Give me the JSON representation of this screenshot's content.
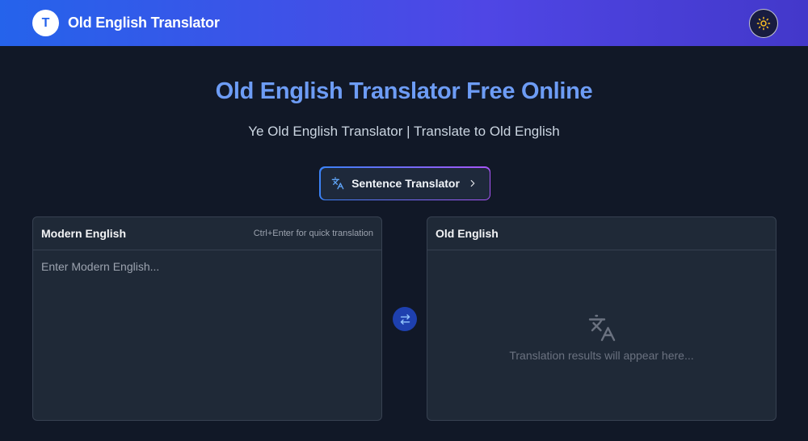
{
  "header": {
    "logo_letter": "T",
    "brand_name": "Old English Translator",
    "theme_icon": "sun-icon"
  },
  "hero": {
    "title": "Old English Translator Free Online",
    "subtitle": "Ye Old English Translator | Translate to Old English"
  },
  "mode_button": {
    "label": "Sentence Translator",
    "icon": "translate-icon",
    "chevron": "chevron-right-icon"
  },
  "source_panel": {
    "title": "Modern English",
    "hint": "Ctrl+Enter for quick translation",
    "value": "",
    "placeholder": "Enter Modern English..."
  },
  "swap_button": {
    "icon": "swap-arrows-icon"
  },
  "target_panel": {
    "title": "Old English",
    "empty_icon": "translate-icon",
    "empty_text": "Translation results will appear here..."
  },
  "colors": {
    "header_gradient_start": "#2563eb",
    "header_gradient_end": "#4338ca",
    "background": "#111827",
    "panel": "#1f2937",
    "hero_title": "#6d9cf5",
    "accent": "#3b82f6",
    "sun": "#fbbf24"
  }
}
